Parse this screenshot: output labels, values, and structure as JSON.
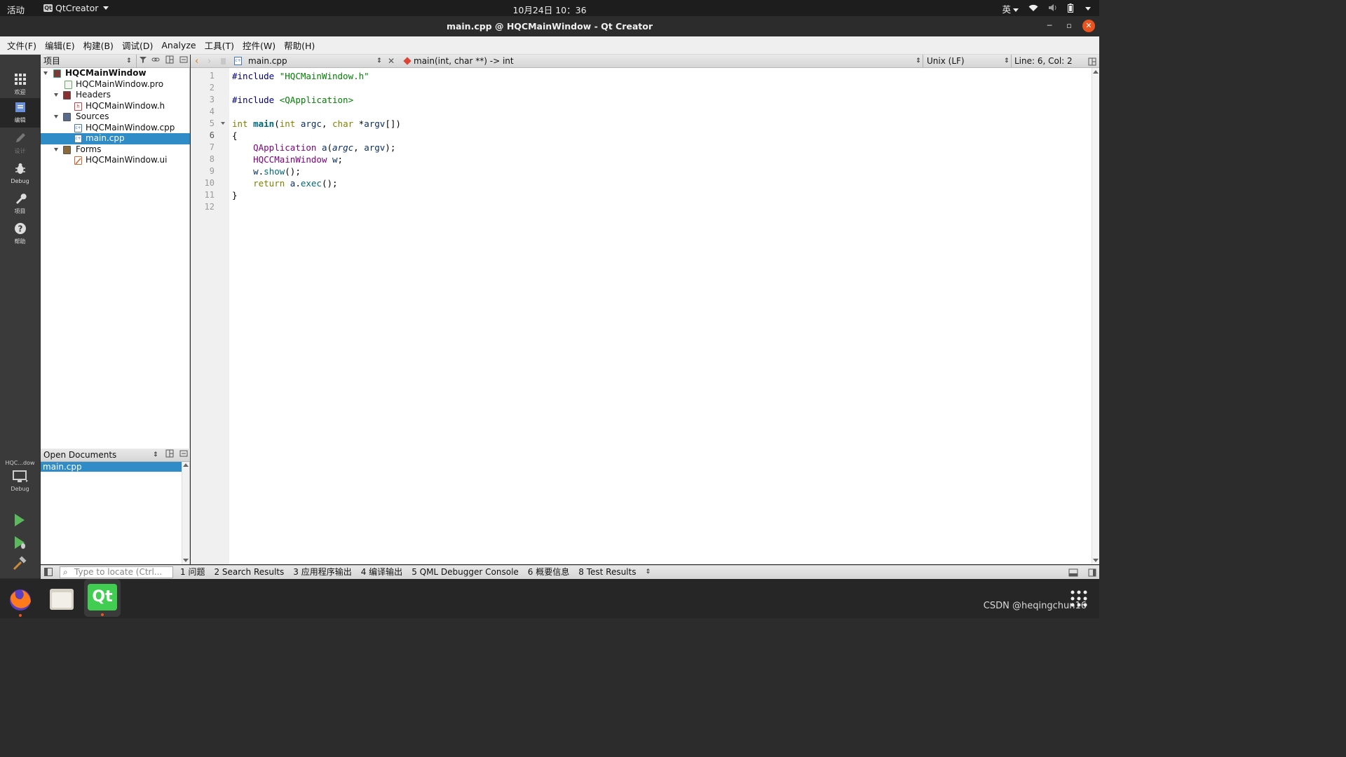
{
  "topbar": {
    "activities": "活动",
    "app_icon_text": "Qt",
    "app_name": "QtCreator",
    "clock": "10月24日 10：36",
    "input_method": "英"
  },
  "window": {
    "title": "main.cpp @ HQCMainWindow - Qt Creator"
  },
  "menu": {
    "items": [
      "文件(F)",
      "编辑(E)",
      "构建(B)",
      "调试(D)",
      "Analyze",
      "工具(T)",
      "控件(W)",
      "帮助(H)"
    ]
  },
  "modes": {
    "welcome": "欢迎",
    "edit": "编辑",
    "design": "设计",
    "debug": "Debug",
    "projects": "项目",
    "help": "帮助"
  },
  "kit": {
    "project": "HQC...dow",
    "build_config": "Debug"
  },
  "projects_panel": {
    "title": "项目",
    "tree": [
      {
        "label": "HQCMainWindow",
        "level": 0,
        "expanded": true,
        "bold": true,
        "icon": "project-icon"
      },
      {
        "label": "HQCMainWindow.pro",
        "level": 1,
        "icon": "pro-file-icon"
      },
      {
        "label": "Headers",
        "level": 1,
        "expanded": true,
        "icon": "headers-folder-icon"
      },
      {
        "label": "HQCMainWindow.h",
        "level": 2,
        "icon": "header-file-icon"
      },
      {
        "label": "Sources",
        "level": 1,
        "expanded": true,
        "icon": "sources-folder-icon"
      },
      {
        "label": "HQCMainWindow.cpp",
        "level": 2,
        "icon": "cpp-file-icon"
      },
      {
        "label": "main.cpp",
        "level": 2,
        "selected": true,
        "icon": "cpp-file-icon"
      },
      {
        "label": "Forms",
        "level": 1,
        "expanded": true,
        "icon": "forms-folder-icon"
      },
      {
        "label": "HQCMainWindow.ui",
        "level": 2,
        "icon": "ui-file-icon"
      }
    ]
  },
  "open_documents": {
    "title": "Open Documents",
    "items": [
      "main.cpp"
    ]
  },
  "editor": {
    "file_name": "main.cpp",
    "symbol": "main(int, char **) -> int",
    "line_ending": "Unix (LF)",
    "position": "Line: 6, Col: 2",
    "current_line": 6,
    "line_numbers": [
      "1",
      "2",
      "3",
      "4",
      "5",
      "6",
      "7",
      "8",
      "9",
      "10",
      "11",
      "12"
    ],
    "code": [
      "#include \"HQCMainWindow.h\"",
      "",
      "#include <QApplication>",
      "",
      "int main(int argc, char *argv[])",
      "{",
      "    QApplication a(argc, argv);",
      "    HQCCMainWindow w;",
      "    w.show();",
      "    return a.exec();",
      "}",
      ""
    ]
  },
  "output_bar": {
    "locate_placeholder": "Type to locate (Ctrl...",
    "tabs": [
      "1 问题",
      "2 Search Results",
      "3 应用程序输出",
      "4 编译输出",
      "5 QML Debugger Console",
      "6 概要信息",
      "8 Test Results"
    ]
  },
  "dock": {
    "apps": [
      "firefox-icon",
      "files-icon",
      "qt-creator-icon"
    ],
    "qt_label": "Qt"
  },
  "watermark": "CSDN @heqingchun16",
  "colors": {
    "selection": "#308cc6",
    "keyword": "#808000",
    "string": "#008000",
    "type": "#800080",
    "ubuntu_orange": "#e95420"
  }
}
